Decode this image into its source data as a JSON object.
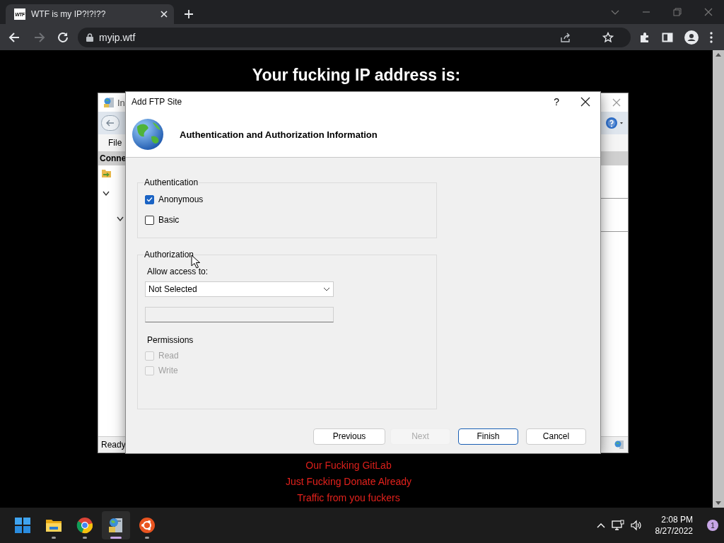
{
  "browser": {
    "tab": {
      "favicon_text": "WTF",
      "title": "WTF is my IP?!?!??"
    },
    "nav_buttons": [
      {
        "kind": "back",
        "disabled": false
      },
      {
        "kind": "forward",
        "disabled": true
      },
      {
        "kind": "reload",
        "disabled": false
      }
    ],
    "url": "myip.wtf"
  },
  "page": {
    "heading": "Your fucking IP address is:",
    "links": [
      "Our Fucking GitLab",
      "Just Fucking Donate Already",
      "Traffic from you fuckers"
    ]
  },
  "iis_window": {
    "title": "In",
    "menu": [
      "File"
    ],
    "pane_header": "Conne",
    "status": "Ready"
  },
  "dialog": {
    "title": "Add FTP Site",
    "help": "?",
    "heading": "Authentication and Authorization Information",
    "authentication": {
      "legend": "Authentication",
      "options": [
        {
          "label": "Anonymous",
          "checked": true
        },
        {
          "label": "Basic",
          "checked": false
        }
      ]
    },
    "authorization": {
      "legend": "Authorization",
      "access_label": "Allow access to:",
      "access_value": "Not Selected",
      "permissions_label": "Permissions",
      "permissions": [
        {
          "label": "Read",
          "checked": false,
          "disabled": true
        },
        {
          "label": "Write",
          "checked": false,
          "disabled": true
        }
      ]
    },
    "buttons": [
      {
        "label": "Previous",
        "disabled": false,
        "default": false
      },
      {
        "label": "Next",
        "disabled": true,
        "default": false
      },
      {
        "label": "Finish",
        "disabled": false,
        "default": true
      },
      {
        "label": "Cancel",
        "disabled": false,
        "default": false
      }
    ]
  },
  "taskbar": {
    "apps": [
      {
        "kind": "start",
        "running": false,
        "active": false
      },
      {
        "kind": "files",
        "running": true,
        "active": false
      },
      {
        "kind": "browser",
        "running": true,
        "active": false
      },
      {
        "kind": "server",
        "running": true,
        "active": true
      },
      {
        "kind": "circle",
        "running": true,
        "active": false
      }
    ],
    "time": "2:08 PM",
    "date": "8/27/2022",
    "notifications": "1"
  }
}
